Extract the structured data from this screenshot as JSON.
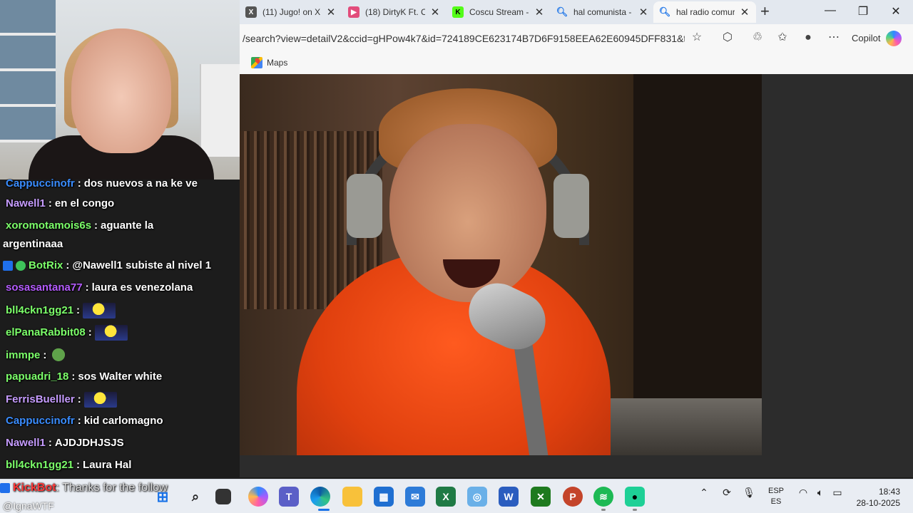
{
  "browser": {
    "tabs": [
      {
        "label": "(11) Jugo! on X:",
        "icon": "x-logo-icon",
        "active": false
      },
      {
        "label": "(18) DirtyK Ft. C",
        "icon": "youtube-icon",
        "active": false
      },
      {
        "label": "Coscu Stream -",
        "icon": "kick-icon",
        "active": false
      },
      {
        "label": "hal comunista -",
        "icon": "search-icon",
        "active": false
      },
      {
        "label": "hal radio comur",
        "icon": "search-icon",
        "active": true
      }
    ],
    "url": "/search?view=detailV2&ccid=gHPow4k7&id=724189CE623174B7D6F9158EEA62E60945DFF831&th...",
    "copilot_label": "Copilot",
    "favorites": [
      {
        "label": "Maps",
        "icon": "maps-icon"
      }
    ]
  },
  "chat": [
    {
      "user": "Cappuccinofr",
      "color": "#3a8dff",
      "text": "dos nuevos a na ke ve",
      "emote": null
    },
    {
      "user": "Nawell1",
      "color": "#c69cff",
      "text": "en el congo",
      "emote": null
    },
    {
      "user": "xoromotamois6s",
      "color": "#7cff6a",
      "text": "aguante la",
      "text2": "argentinaaa",
      "emote": null
    },
    {
      "user": "BotRix",
      "color": "#7cff6a",
      "text": "@Nawell1 subiste al nivel 1",
      "emote": null,
      "badges": true
    },
    {
      "user": "sosasantana77",
      "color": "#b55cff",
      "text": "laura es venezolana",
      "emote": null
    },
    {
      "user": "bll4ckn1gg21",
      "color": "#7cff6a",
      "text": "",
      "emote": "minion"
    },
    {
      "user": "elPanaRabbit08",
      "color": "#7cff6a",
      "text": "",
      "emote": "minion"
    },
    {
      "user": "immpe",
      "color": "#7cff6a",
      "text": "",
      "emote": "pepe"
    },
    {
      "user": "papuadri_18",
      "color": "#7cff6a",
      "text": "sos Walter white",
      "emote": null
    },
    {
      "user": "FerrisBuelller",
      "color": "#c69cff",
      "text": "",
      "emote": "minion"
    },
    {
      "user": "Cappuccinofr",
      "color": "#3a8dff",
      "text": "kid carlomagno",
      "emote": null
    },
    {
      "user": "Nawell1",
      "color": "#c69cff",
      "text": "AJDJDHJSJS",
      "emote": null
    },
    {
      "user": "bll4ckn1gg21",
      "color": "#7cff6a",
      "text": "Laura Hal",
      "emote": null
    }
  ],
  "kickbot": {
    "name": "KickBot",
    "message": ": Thanks for the follow"
  },
  "handle": "@IgnaWTF",
  "taskbar": {
    "apps": [
      "start-icon",
      "search-icon",
      "task-view-icon",
      "copilot-icon",
      "teams-icon",
      "edge-icon",
      "file-explorer-icon",
      "store-icon",
      "mail-icon",
      "excel-icon",
      "photos-icon",
      "word-icon",
      "xbox-icon",
      "powerpoint-icon",
      "spotify-icon",
      "chat-app-icon"
    ],
    "lang_top": "ESP",
    "lang_bottom": "ES",
    "time": "18:43",
    "date": "28-10-2025"
  }
}
